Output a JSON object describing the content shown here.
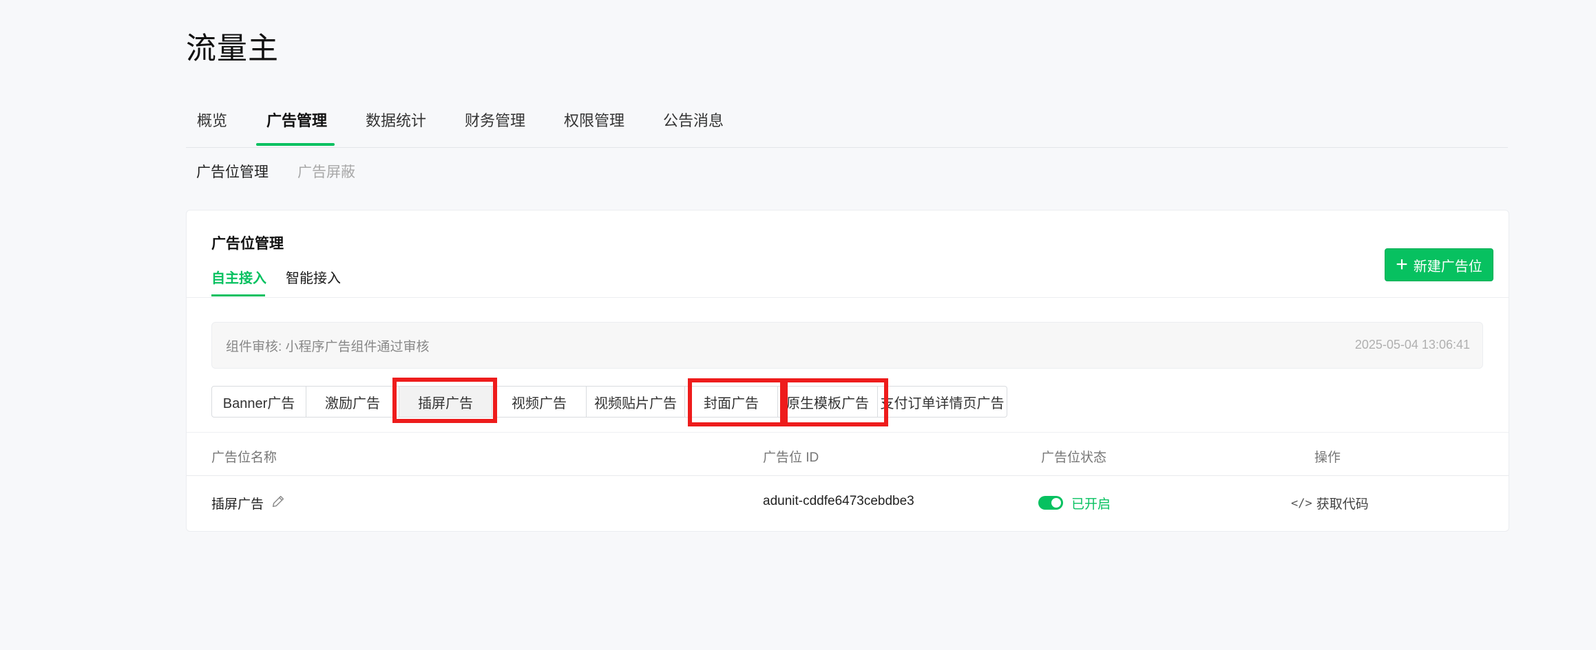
{
  "page": {
    "title": "流量主"
  },
  "main_tabs": [
    {
      "label": "概览"
    },
    {
      "label": "广告管理",
      "active": true
    },
    {
      "label": "数据统计"
    },
    {
      "label": "财务管理"
    },
    {
      "label": "权限管理"
    },
    {
      "label": "公告消息"
    }
  ],
  "sub_tabs": [
    {
      "label": "广告位管理",
      "active": true
    },
    {
      "label": "广告屏蔽"
    }
  ],
  "card": {
    "title": "广告位管理",
    "inner_tabs": [
      {
        "label": "自主接入",
        "active": true
      },
      {
        "label": "智能接入"
      }
    ],
    "create_button": "新建广告位",
    "notice": {
      "text": "组件审核: 小程序广告组件通过审核",
      "time": "2025-05-04 13:06:41"
    },
    "ad_types": [
      {
        "label": "Banner广告"
      },
      {
        "label": "激励广告"
      },
      {
        "label": "插屏广告",
        "selected": true,
        "highlighted": true
      },
      {
        "label": "视频广告"
      },
      {
        "label": "视频贴片广告"
      },
      {
        "label": "封面广告",
        "highlighted": true
      },
      {
        "label": "原生模板广告",
        "highlighted": true
      },
      {
        "label": "支付订单详情页广告"
      }
    ],
    "table": {
      "headers": [
        "广告位名称",
        "广告位 ID",
        "广告位状态",
        "操作"
      ],
      "rows": [
        {
          "name": "插屏广告",
          "id": "adunit-cddfe6473cebdbe3",
          "status": "已开启",
          "action": "获取代码"
        }
      ]
    }
  },
  "colors": {
    "accent": "#07c160",
    "highlight": "#ee1c1c"
  },
  "icons": {
    "create": "plus-icon",
    "edit": "pencil-icon",
    "code": "code-icon",
    "status": "toggle-on-icon"
  }
}
